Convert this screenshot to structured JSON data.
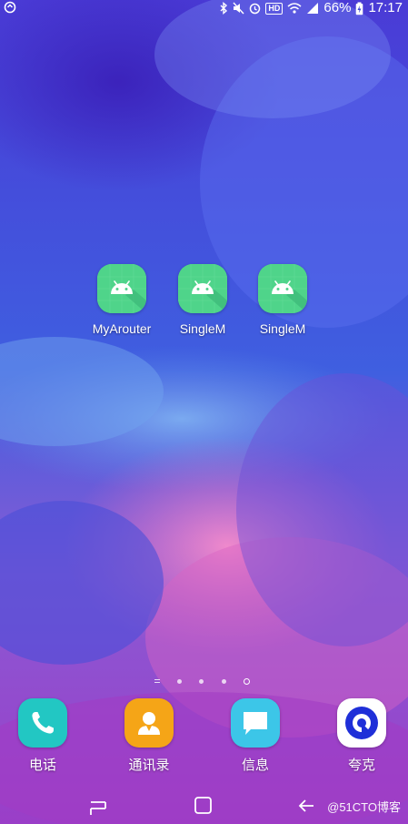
{
  "status_bar": {
    "hd_badge": "HD",
    "battery_percent": "66%",
    "time": "17:17"
  },
  "apps": [
    {
      "label": "MyArouter",
      "icon": "android-icon"
    },
    {
      "label": "SingleM",
      "icon": "android-icon"
    },
    {
      "label": "SingleM",
      "icon": "android-icon"
    }
  ],
  "page_indicator": {
    "pages": 5,
    "current_page": 5
  },
  "dock": [
    {
      "label": "电话",
      "icon": "phone-icon",
      "color": "#22c7c3"
    },
    {
      "label": "通讯录",
      "icon": "contacts-icon",
      "color": "#f5a517"
    },
    {
      "label": "信息",
      "icon": "message-icon",
      "color": "#3cc6e8"
    },
    {
      "label": "夸克",
      "icon": "quark-icon",
      "color": "#ffffff"
    }
  ],
  "watermark": "@51CTO博客",
  "colors": {
    "app_icon_bg": "#4fd48a",
    "quark_blue": "#1f2fd8"
  }
}
